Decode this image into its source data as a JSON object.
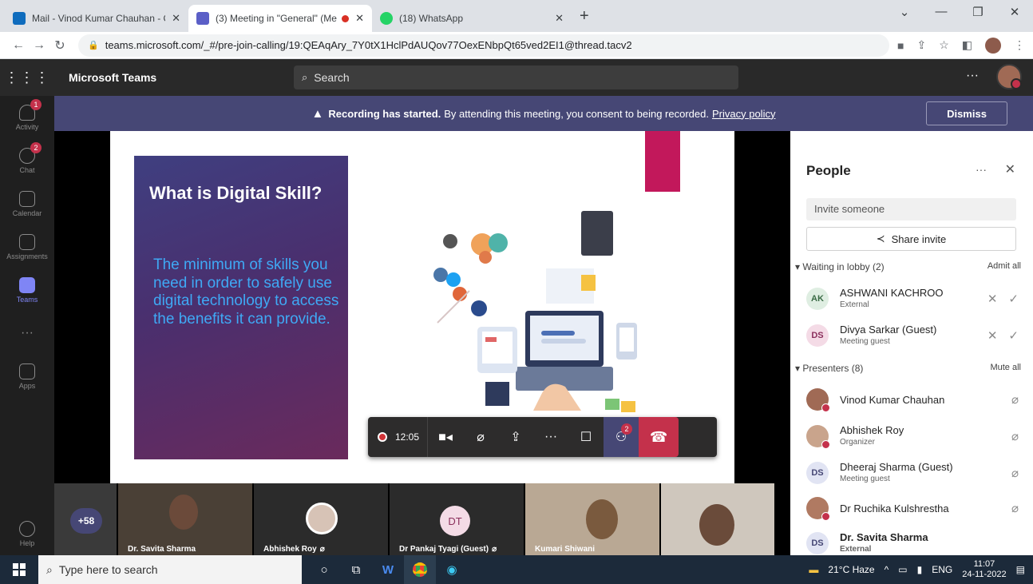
{
  "browser": {
    "tabs": [
      {
        "title": "Mail - Vinod Kumar Chauhan - O",
        "favicon_color": "#0f6cbd"
      },
      {
        "title": "(3) Meeting in \"General\" (Me",
        "favicon_color": "#5b5fc7",
        "recording": true
      },
      {
        "title": "(18) WhatsApp",
        "favicon_color": "#25d366"
      }
    ],
    "new_tab": "+",
    "url": "teams.microsoft.com/_#/pre-join-calling/19:QEAqAry_7Y0tX1HclPdAUQov77OexENbpQt65ved2EI1@thread.tacv2"
  },
  "teams": {
    "app_name": "Microsoft Teams",
    "search_placeholder": "Search",
    "rail": [
      {
        "label": "Activity",
        "badge": "1"
      },
      {
        "label": "Chat",
        "badge": "2"
      },
      {
        "label": "Calendar",
        "badge": ""
      },
      {
        "label": "Assignments",
        "badge": ""
      },
      {
        "label": "Teams",
        "badge": "",
        "active": true
      },
      {
        "label": "Apps",
        "badge": ""
      }
    ],
    "help_label": "Help"
  },
  "banner": {
    "bold": "Recording has started.",
    "text": "By attending this meeting, you consent to being recorded.",
    "link": "Privacy policy",
    "dismiss": "Dismiss"
  },
  "slide": {
    "title": "What is Digital Skill?",
    "body": "The minimum of skills you need in order to safely use digital technology to access the benefits it can provide.",
    "presenter": "Dr. Savita Sharma"
  },
  "controls": {
    "timer": "12:05",
    "people_badge": "2"
  },
  "gallery": {
    "more": "+58",
    "tiles": [
      {
        "name": "Dr. Savita Sharma",
        "muted": false
      },
      {
        "name": "Abhishek Roy",
        "muted": true
      },
      {
        "name": "Dr Pankaj Tyagi (Guest)",
        "initials": "DT",
        "muted": true
      },
      {
        "name": "Kumari Shiwani",
        "muted": false
      },
      {
        "name": "",
        "muted": false
      }
    ]
  },
  "people": {
    "title": "People",
    "invite_placeholder": "Invite someone",
    "share_invite": "Share invite",
    "lobby": {
      "label": "Waiting in lobby (2)",
      "action": "Admit all"
    },
    "lobby_people": [
      {
        "initials": "AK",
        "name": "ASHWANI KACHROO",
        "sub": "External",
        "bg": "#dfeee2",
        "fg": "#3a6b45"
      },
      {
        "initials": "DS",
        "name": "Divya Sarkar (Guest)",
        "sub": "Meeting guest",
        "bg": "#f4dbe6",
        "fg": "#8b2f5c"
      }
    ],
    "presenters": {
      "label": "Presenters (8)",
      "action": "Mute all"
    },
    "presenter_people": [
      {
        "initials": "",
        "name": "Vinod Kumar Chauhan",
        "sub": "",
        "bg": "#a06a55",
        "photo": true
      },
      {
        "initials": "",
        "name": "Abhishek Roy",
        "sub": "Organizer",
        "bg": "#c9a48c",
        "photo": true
      },
      {
        "initials": "DS",
        "name": "Dheeraj Sharma (Guest)",
        "sub": "Meeting guest",
        "bg": "#e1e4f3",
        "fg": "#464775"
      },
      {
        "initials": "",
        "name": "Dr Ruchika Kulshrestha",
        "sub": "",
        "bg": "#b07a62",
        "photo": true
      },
      {
        "initials": "DS",
        "name": "Dr. Savita Sharma",
        "sub": "External",
        "bg": "#e1e4f3",
        "fg": "#464775",
        "bold": true
      }
    ]
  },
  "taskbar": {
    "search_placeholder": "Type here to search",
    "weather": "21°C Haze",
    "lang": "ENG",
    "time": "11:07",
    "date": "24-11-2022"
  }
}
